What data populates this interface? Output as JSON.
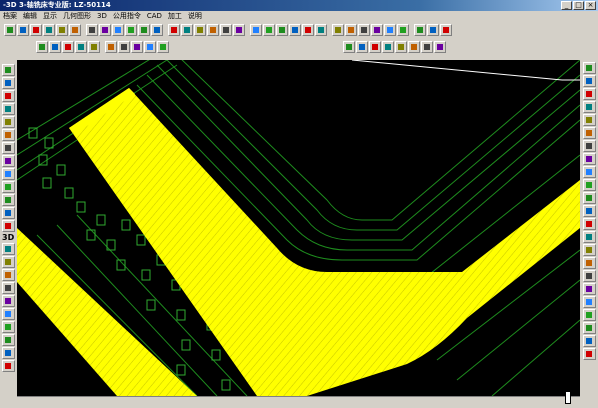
{
  "window": {
    "title": "-3D 3-轴铣床专业版: LZ-50114",
    "min_label": "_",
    "max_label": "□",
    "close_label": "×"
  },
  "menu": [
    "档案",
    "编辑",
    "显示",
    "几何图形",
    "3D",
    "公用指令",
    "CAD",
    "加工",
    "说明"
  ],
  "left_toolbar_label": "3D",
  "colors": {
    "background": "#000000",
    "toolpath": "#ffff00",
    "wireframe": "#1e8c1e",
    "accent_red": "#d00000",
    "titlebar": "#0a246a"
  },
  "toolbar_row1_icons": [
    "check-icon",
    "redo-icon",
    "rotate-icon",
    "zoom-window-icon",
    "zoom-extents-icon",
    "measure-icon",
    "move-icon",
    "grid-icon",
    "line-icon",
    "arc-icon",
    "trim-icon",
    "offset-icon",
    "mirror-icon",
    "rotate-obj-icon",
    "scale-icon",
    "circle-icon",
    "hatch-icon",
    "delete-icon",
    "cut-icon",
    "green-arrow-icon",
    "wave-icon",
    "spiral-icon",
    "pocket-icon",
    "contour-icon",
    "drill-icon",
    "face-icon",
    "ramp-icon",
    "helix-icon",
    "slot-icon",
    "chamfer-icon",
    "thread-icon",
    "engrave-icon",
    "color-icon"
  ],
  "toolbar_row2_icons": [
    "new-icon",
    "open-icon",
    "save-icon",
    "print-icon",
    "copy-icon",
    "paste-icon",
    "undo-icon",
    "redo2-icon",
    "layer-icon",
    "select-icon"
  ],
  "toolbar_row2b_icons": [
    "yellow-square-icon",
    "line-tool-icon",
    "play-icon",
    "verify-icon",
    "sim-icon",
    "path-icon",
    "center-icon",
    "chain-icon"
  ],
  "left_icons": [
    "zoom-icon",
    "pan-icon",
    "zoom-in-icon",
    "zoom-out-icon",
    "fit-icon",
    "view-icon",
    "layer-icon",
    "light-icon",
    "front-icon",
    "shade-icon",
    "edge-icon",
    "snap-icon",
    "wire-icon",
    "iso-icon",
    "solid-icon",
    "mesh-icon",
    "tool-icon",
    "grid2-icon",
    "axis-icon",
    "point-icon",
    "vector-icon",
    "color2-icon",
    "info-icon"
  ],
  "right_icons": [
    "r-zoom-icon",
    "r-person-icon",
    "r-axis-icon",
    "r-dim-icon",
    "r-solid-icon",
    "r-tool-icon",
    "r-path-icon",
    "r-color-icon",
    "r-view-icon",
    "r-shade-icon",
    "r-edge-icon",
    "r-mesh-icon",
    "r-check-icon",
    "r-list-icon",
    "r-list2-icon",
    "r-list3-icon",
    "r-list4-icon",
    "r-list5-icon",
    "r-list6-icon",
    "r-list7-icon",
    "r-list8-icon",
    "r-list9-icon",
    "r-list10-icon"
  ]
}
